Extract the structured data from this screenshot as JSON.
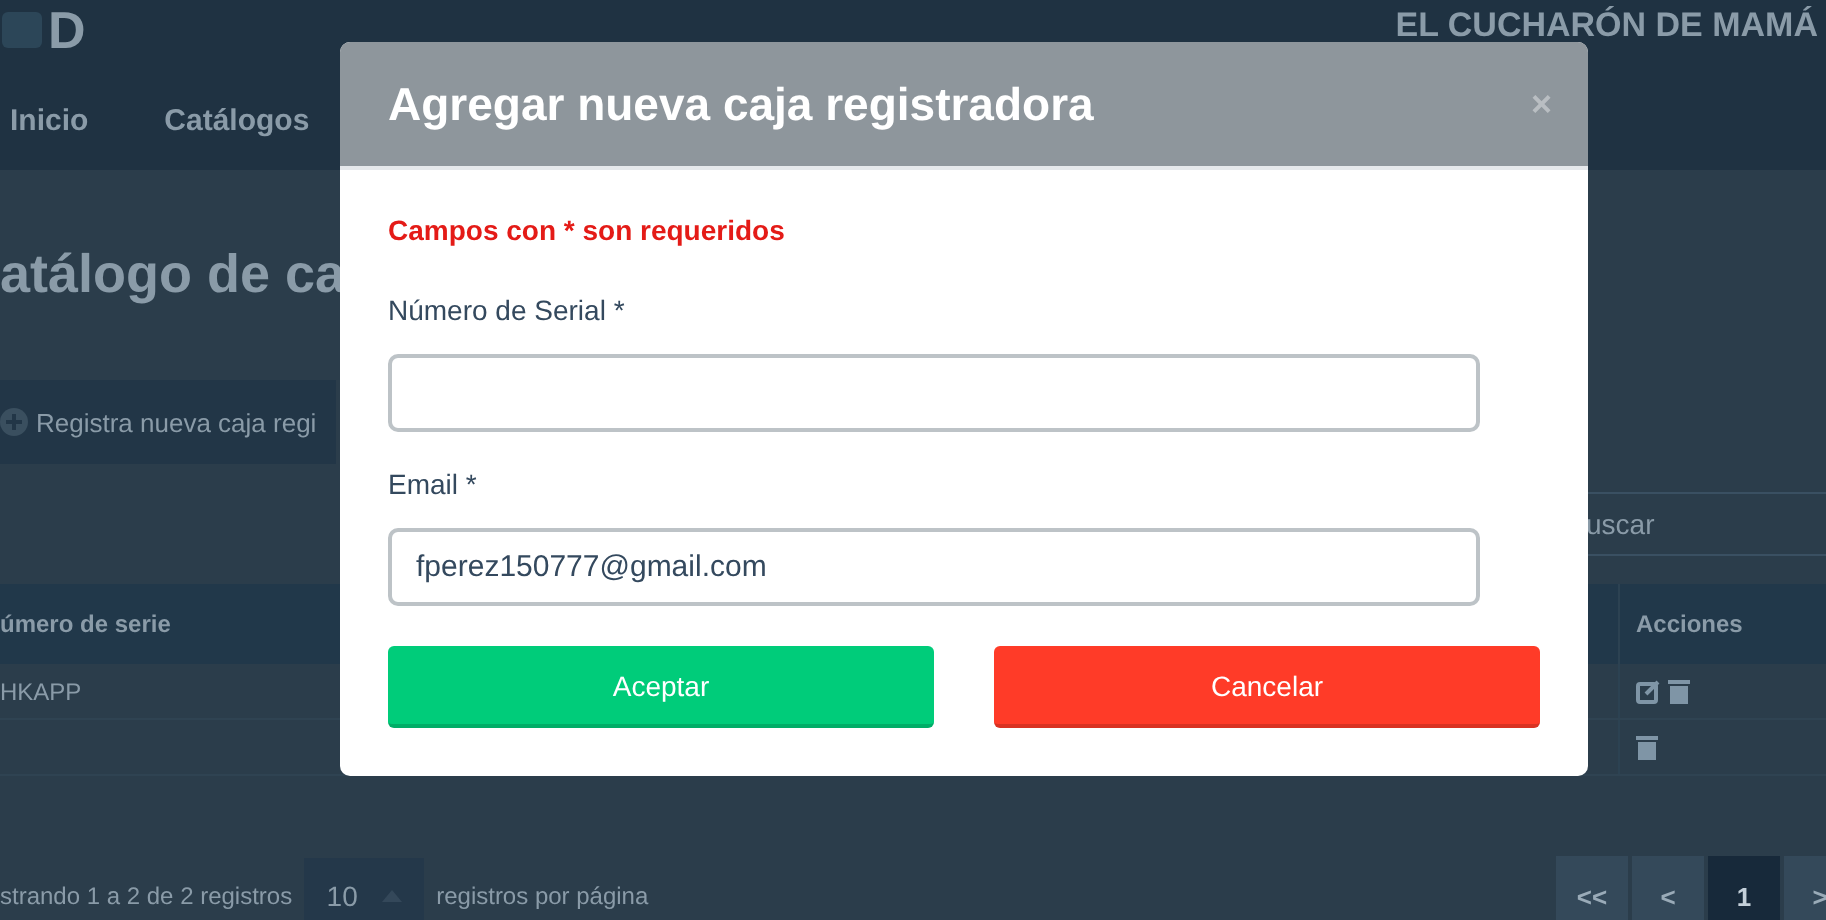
{
  "header": {
    "logo_text": "D",
    "brand": "EL CUCHARÓN DE MAMÁ"
  },
  "nav": [
    {
      "label": "Inicio"
    },
    {
      "label": "Catálogos"
    }
  ],
  "page": {
    "title": "atálogo de ca",
    "add_button": "Registra nueva caja regi",
    "search": {
      "placeholder": "uscar"
    },
    "table": {
      "columns": [
        "úmero de serie",
        "Acciones"
      ],
      "rows": [
        {
          "column_1": "HKAPP",
          "actions": [
            {
              "kind": "edit"
            },
            {
              "kind": "delete"
            }
          ]
        },
        {
          "actions": [
            {
              "kind": "delete"
            }
          ]
        }
      ]
    },
    "footer": {
      "info": "strando 1 a 2 de 2 registros",
      "page_size": "10",
      "page_size_suffix": "registros por página"
    },
    "pagination": [
      {
        "label": "<<",
        "selected": false
      },
      {
        "label": "<",
        "selected": false
      },
      {
        "label": "1",
        "selected": true
      },
      {
        "label": ">",
        "selected": false
      }
    ]
  },
  "modal": {
    "title": "Agregar nueva caja registradora",
    "close": "×",
    "note": "Campos con * son requeridos",
    "fields": [
      {
        "label": "Número de Serial *"
      },
      {
        "label": "Email *",
        "value": "fperez150777@gmail.com"
      }
    ],
    "buttons": [
      {
        "label": "Aceptar",
        "kind": "primary"
      },
      {
        "label": "Cancelar",
        "kind": "danger"
      }
    ]
  }
}
